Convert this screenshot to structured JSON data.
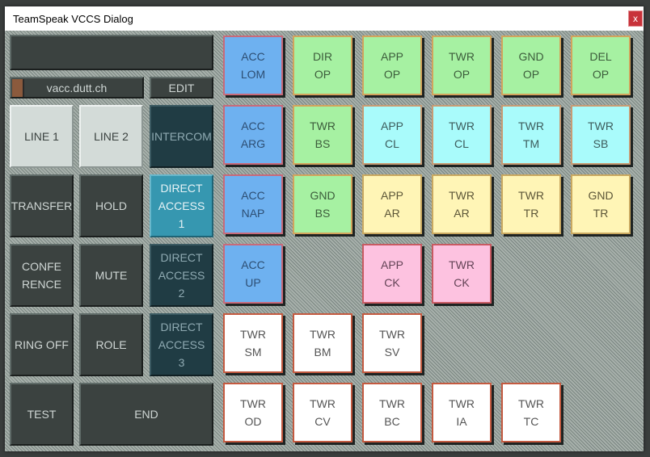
{
  "window": {
    "title": "TeamSpeak VCCS Dialog",
    "close_label": "x"
  },
  "server": {
    "address": "vacc.dutt.ch",
    "edit_label": "EDIT"
  },
  "controls": {
    "line1": "LINE 1",
    "line2": "LINE 2",
    "intercom": "INTERCOM",
    "transfer": "TRANSFER",
    "hold": "HOLD",
    "direct_access_1": [
      "DIRECT",
      "ACCESS",
      "1"
    ],
    "conference": [
      "CONFE",
      "RENCE"
    ],
    "mute": "MUTE",
    "direct_access_2": [
      "DIRECT",
      "ACCESS",
      "2"
    ],
    "ring_off": "RING OFF",
    "role": "ROLE",
    "direct_access_3": [
      "DIRECT",
      "ACCESS",
      "3"
    ],
    "test": "TEST",
    "end": "END"
  },
  "colors": {
    "blue": "#6eb1f0",
    "green": "#a6f1a2",
    "cyan": "#a9fbfb",
    "yellow": "#fff5b6",
    "pink": "#fdc2e0",
    "white": "#ffffff",
    "active": "#3697b0"
  },
  "stations": {
    "acc_lom": [
      "ACC",
      "LOM"
    ],
    "dir_op": [
      "DIR",
      "OP"
    ],
    "app_op": [
      "APP",
      "OP"
    ],
    "twr_op": [
      "TWR",
      "OP"
    ],
    "gnd_op": [
      "GND",
      "OP"
    ],
    "del_op": [
      "DEL",
      "OP"
    ],
    "acc_arg": [
      "ACC",
      "ARG"
    ],
    "twr_bs": [
      "TWR",
      "BS"
    ],
    "app_cl": [
      "APP",
      "CL"
    ],
    "twr_cl": [
      "TWR",
      "CL"
    ],
    "twr_tm": [
      "TWR",
      "TM"
    ],
    "twr_sb": [
      "TWR",
      "SB"
    ],
    "acc_nap": [
      "ACC",
      "NAP"
    ],
    "gnd_bs": [
      "GND",
      "BS"
    ],
    "app_ar": [
      "APP",
      "AR"
    ],
    "twr_ar": [
      "TWR",
      "AR"
    ],
    "twr_tr": [
      "TWR",
      "TR"
    ],
    "gnd_tr": [
      "GND",
      "TR"
    ],
    "acc_up": [
      "ACC",
      "UP"
    ],
    "app_ck": [
      "APP",
      "CK"
    ],
    "twr_ck": [
      "TWR",
      "CK"
    ],
    "twr_sm": [
      "TWR",
      "SM"
    ],
    "twr_bm": [
      "TWR",
      "BM"
    ],
    "twr_sv": [
      "TWR",
      "SV"
    ],
    "twr_od": [
      "TWR",
      "OD"
    ],
    "twr_cv": [
      "TWR",
      "CV"
    ],
    "twr_bc": [
      "TWR",
      "BC"
    ],
    "twr_ia": [
      "TWR",
      "IA"
    ],
    "twr_tc": [
      "TWR",
      "TC"
    ]
  }
}
